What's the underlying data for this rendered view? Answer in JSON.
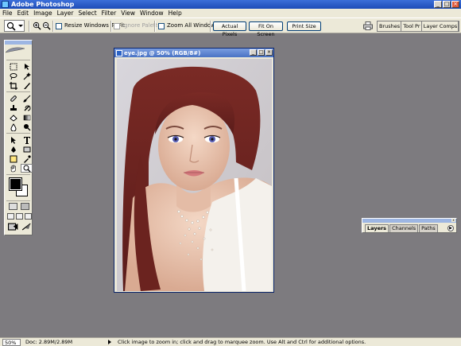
{
  "window": {
    "title": "Adobe Photoshop"
  },
  "menu": [
    "File",
    "Edit",
    "Image",
    "Layer",
    "Select",
    "Filter",
    "View",
    "Window",
    "Help"
  ],
  "options": {
    "resize_windows": "Resize Windows To Fit",
    "ignore_palettes": "Ignore Palettes",
    "zoom_all_windows": "Zoom All Windows",
    "actual_pixels": "Actual Pixels",
    "fit_on_screen": "Fit On Screen",
    "print_size": "Print Size"
  },
  "palette_well": [
    "Brushes",
    "Tool Pr",
    "Layer Comps"
  ],
  "document": {
    "title": "eye.jpg @ 50% (RGB/8#)"
  },
  "layers_palette": {
    "tabs": [
      "Layers",
      "Channels",
      "Paths"
    ]
  },
  "status": {
    "zoom": "50%",
    "doc": "Doc: 2.89M/2.89M",
    "hint": "Click image to zoom in; click and drag to marquee zoom.  Use Alt and Ctrl for additional options."
  },
  "colors": {
    "foreground": "#000000",
    "background": "#ffffff",
    "titlebar": "#1d4cb7"
  }
}
